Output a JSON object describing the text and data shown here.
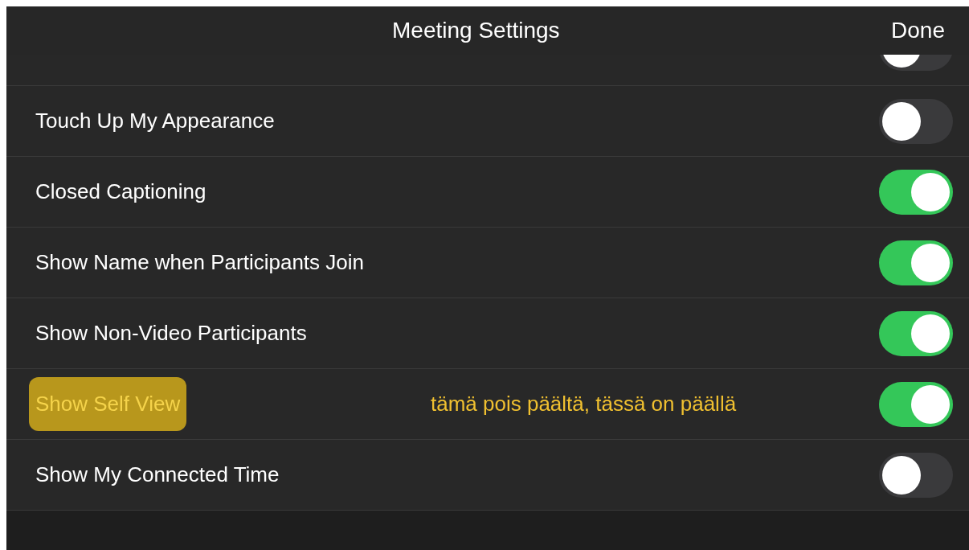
{
  "header": {
    "title": "Meeting Settings",
    "done": "Done"
  },
  "partial_row": {
    "on": false
  },
  "rows": [
    {
      "label": "Touch Up My Appearance",
      "on": false,
      "highlighted": false
    },
    {
      "label": "Closed Captioning",
      "on": true,
      "highlighted": false
    },
    {
      "label": "Show Name when Participants Join",
      "on": true,
      "highlighted": false
    },
    {
      "label": "Show Non-Video Participants",
      "on": true,
      "highlighted": false
    },
    {
      "label": "Show Self View",
      "on": true,
      "highlighted": true,
      "note": "tämä pois päältä, tässä on päällä"
    },
    {
      "label": "Show My Connected Time",
      "on": false,
      "highlighted": false
    }
  ]
}
